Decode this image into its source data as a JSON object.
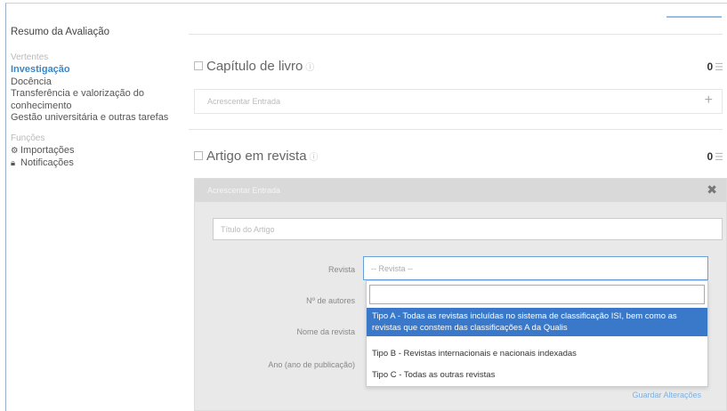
{
  "sidebar": {
    "title": "Resumo da Avaliação",
    "section_vertentes": "Vertentes",
    "items": [
      {
        "label": "Investigação"
      },
      {
        "label": "Docência"
      },
      {
        "label": "Transferência e valorização do conhecimento"
      },
      {
        "label": "Gestão universitária e outras tarefas"
      }
    ],
    "section_funcoes": "Funções",
    "tools": [
      {
        "icon": "cog-icon",
        "label": "Importações"
      },
      {
        "icon": "lock-icon",
        "label": "Notificações"
      }
    ]
  },
  "sections": [
    {
      "title": "Capítulo de livro",
      "count": "0",
      "add_label": "Acrescentar Entrada"
    },
    {
      "title": "Artigo em revista",
      "count": "0",
      "add_label": "Acrescentar Entrada"
    }
  ],
  "form": {
    "title_placeholder": "Título do Artigo",
    "labels": {
      "revista": "Revista",
      "autores": "Nº de autores",
      "nome_revista": "Nome da revista",
      "ano": "Ano (ano de publicação)"
    },
    "select_value": "-- Revista --",
    "options": [
      "Tipo A - Todas as revistas incluídas no sistema de classificação ISI, bem como as revistas que constem das classificações A da Qualis",
      "Tipo B - Revistas internacionais e nacionais indexadas",
      "Tipo C - Todas as outras revistas"
    ],
    "more_link": "Guardar Alterações"
  },
  "colors": {
    "accent": "#3a87c8",
    "highlight": "#3a78c9"
  }
}
